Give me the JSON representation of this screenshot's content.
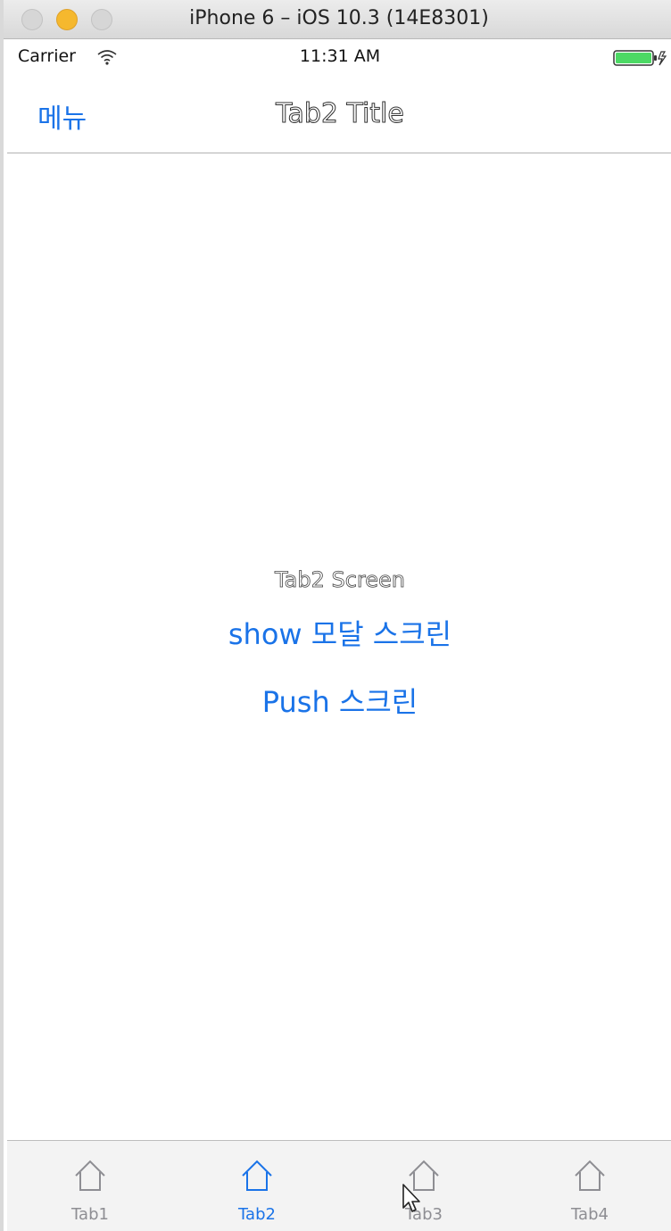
{
  "window": {
    "title": "iPhone 6 – iOS 10.3 (14E8301)"
  },
  "status_bar": {
    "carrier": "Carrier",
    "time": "11:31 AM",
    "wifi_icon": "wifi-icon",
    "battery_icon": "battery-icon",
    "battery_color": "#4cd964"
  },
  "nav_bar": {
    "left_button": "메뉴",
    "title": "Tab2 Title"
  },
  "content": {
    "screen_label": "Tab2 Screen",
    "show_modal_button": "show 모달 스크린",
    "push_button": "Push 스크린"
  },
  "tab_bar": {
    "items": [
      {
        "label": "Tab1",
        "icon": "home-icon",
        "selected": false
      },
      {
        "label": "Tab2",
        "icon": "home-icon",
        "selected": true
      },
      {
        "label": "Tab3",
        "icon": "home-icon",
        "selected": false
      },
      {
        "label": "Tab4",
        "icon": "home-icon",
        "selected": false
      }
    ]
  },
  "colors": {
    "accent": "#1a73e8",
    "inactive": "#8e8e93"
  }
}
